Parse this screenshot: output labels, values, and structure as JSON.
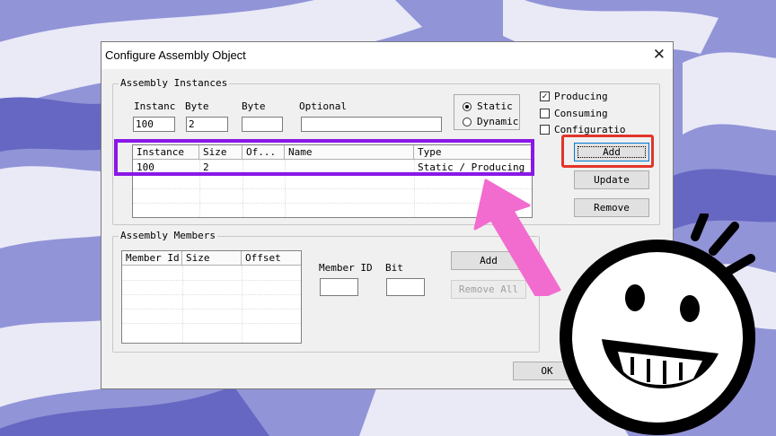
{
  "window": {
    "title": "Configure Assembly Object",
    "close_glyph": "✕"
  },
  "assembly_instances": {
    "group_label": "Assembly Instances",
    "instance_label": "Instanc",
    "instance_value": "100",
    "size_label": "Byte",
    "size_value": "2",
    "offset_label": "Byte",
    "offset_value": "",
    "optional_label": "Optional",
    "optional_value": "",
    "static_label": "Static",
    "dynamic_label": "Dynamic",
    "producing_label": "Producing",
    "consuming_label": "Consuming",
    "configuration_label": "Configuratio",
    "columns": [
      "Instance",
      "Size",
      "Of...",
      "Name",
      "Type"
    ],
    "rows": [
      {
        "instance": "100",
        "size": "2",
        "offset": "",
        "name": "",
        "type": "Static / Producing"
      }
    ],
    "add_button": "Add",
    "update_button": "Update",
    "remove_button": "Remove"
  },
  "assembly_members": {
    "group_label": "Assembly Members",
    "columns": [
      "Member Id",
      "Size",
      "Offset"
    ],
    "member_id_label": "Member ID",
    "member_id_value": "",
    "bit_label": "Bit",
    "bit_value": "",
    "add_button": "Add",
    "remove_all_button": "Remove All"
  },
  "footer": {
    "ok_button": "OK"
  },
  "colors": {
    "highlight_purple": "#8a18e6",
    "highlight_red": "#e2342a",
    "arrow_pink": "#f26ccf",
    "background": "#8f90d6"
  },
  "icons": {
    "arrow": "pink-arrow-icon",
    "smiley": "smiley-face-icon"
  }
}
